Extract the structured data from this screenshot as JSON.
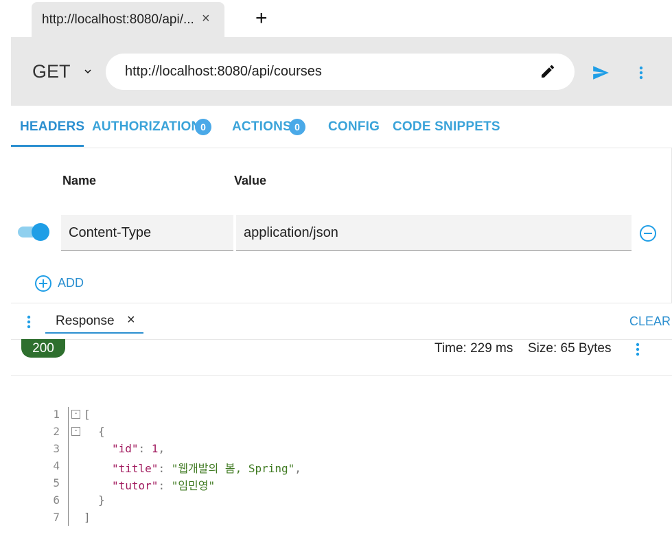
{
  "tabs": {
    "active_label": "http://localhost:8080/api/...",
    "close_glyph": "×",
    "add_glyph": "+"
  },
  "request": {
    "method": "GET",
    "url": "http://localhost:8080/api/courses"
  },
  "nav": {
    "headers": "HEADERS",
    "authorization": "AUTHORIZATION",
    "authorization_count": "0",
    "actions": "ACTIONS",
    "actions_count": "0",
    "config": "CONFIG",
    "code_snippets": "CODE SNIPPETS"
  },
  "headers_table": {
    "col_name": "Name",
    "col_value": "Value",
    "rows": [
      {
        "enabled": true,
        "name": "Content-Type",
        "value": "application/json"
      }
    ],
    "add_label": "ADD"
  },
  "response": {
    "tab_label": "Response",
    "close_glyph": "×",
    "clear_label": "CLEAR",
    "status": "200",
    "time": "Time: 229 ms",
    "size": "Size: 65 Bytes"
  },
  "code": {
    "line_numbers": [
      "1",
      "2",
      "3",
      "4",
      "5",
      "6",
      "7"
    ],
    "fold_glyph": "-",
    "open_bracket": "[",
    "open_brace": "{",
    "close_brace": "}",
    "close_bracket": "]",
    "fields": [
      {
        "key": "\"id\"",
        "sep": ": ",
        "value": "1",
        "trail": ","
      },
      {
        "key": "\"title\"",
        "sep": ": ",
        "value": "\"웹개발의 봄, Spring\"",
        "trail": ","
      },
      {
        "key": "\"tutor\"",
        "sep": ": ",
        "value": "\"임민영\"",
        "trail": ""
      }
    ]
  },
  "colors": {
    "accent": "#2b8fd0",
    "status_ok": "#2e6f2e",
    "toolbar_bg": "#e8e8e8"
  },
  "icons": [
    "close-icon",
    "plus-icon",
    "chevron-down-icon",
    "pencil-icon",
    "send-icon",
    "more-vert-icon",
    "minus-circle-icon",
    "plus-circle-icon"
  ]
}
